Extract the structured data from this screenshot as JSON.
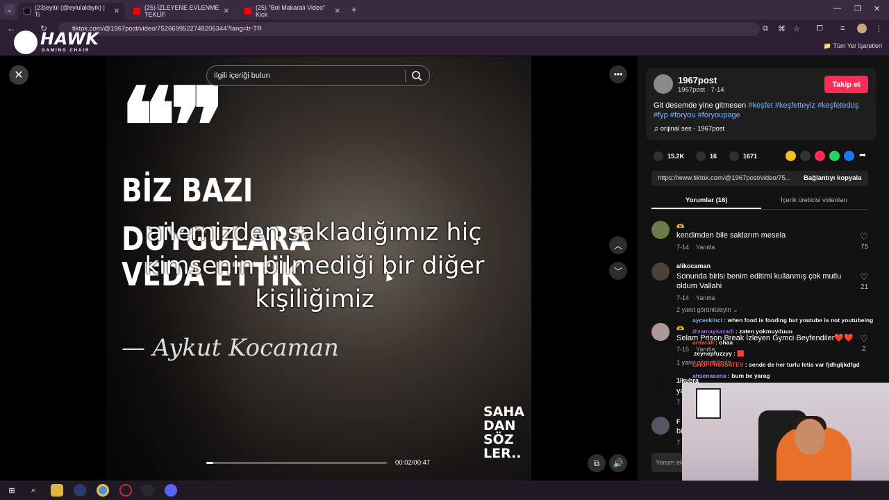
{
  "browser": {
    "tabs": [
      {
        "label": "(23)eylül (@eylulakbyik) | Ti",
        "active": true
      },
      {
        "label": "(25) İZLEYENE EVLENME TEKLİF",
        "active": false
      },
      {
        "label": "(25) \"Bol Makaralı Video\" Kick",
        "active": false
      }
    ],
    "new_tab": "+",
    "url": "tiktok.com/@1967post/video/7526699522748206344?lang=tr-TR",
    "bookmarks_all": "Tüm Yer İşaretleri"
  },
  "overlay_logo": {
    "brand": "HAWK",
    "sub": "GAMING CHAIR"
  },
  "search": {
    "placeholder": "İlgili içeriği bulun"
  },
  "video": {
    "bg_title_1": "BİZ BAZI",
    "bg_title_2": "DUYGULARA",
    "bg_title_3": "VEDA ETTİK",
    "overlay_text": "ailemizden sakladığımız hiç kimsenin bilmediği bir diğer kişiliğimiz",
    "signature": "— Aykut Kocaman",
    "watermark": "SAHA DAN SÖZ LER..",
    "time": "00:02/00:47",
    "progress": 0.04
  },
  "author": {
    "name": "1967post",
    "sub": "1967post · 7-14",
    "follow": "Takip et",
    "desc_text": "Git desemde yine gitmesen",
    "hashtags_line1": "#keşfet #keşfetteyiz #keşfetedüş",
    "hashtags_line2": "#fyp #foryou #foryoupage",
    "sound": "orijinal ses - 1967post"
  },
  "stats": {
    "likes": "15.2K",
    "comments": "16",
    "saves": "1671"
  },
  "link": {
    "url": "https://www.tiktok.com/@1967post/video/75...",
    "copy": "Bağlantıyı kopyala"
  },
  "tabs": {
    "comments": "Yorumlar (16)",
    "creator": "İçerik üreticisi videoları"
  },
  "comments": [
    {
      "user": "🫶",
      "text": "kendimden bile saklarım mesela",
      "date": "7-14",
      "reply": "Yanıtla",
      "likes": "75"
    },
    {
      "user": "alikocaman",
      "text": "Sonunda birisi benim editimi kullanmış çok mutlu oldum Vallahi",
      "date": "7-14",
      "reply": "Yanıtla",
      "likes": "21",
      "replies": "2 yanıt görüntüleyin"
    },
    {
      "user": "🫶",
      "text": "Selam Prison Break İzleyen Gymci Beyfendiler❤️❤️",
      "date": "7-15",
      "reply": "Yanıtla",
      "likes": "2",
      "replies": "1 yanıt görüntüleyin"
    },
    {
      "user": "1lkubra",
      "text": "ya",
      "date": "7"
    },
    {
      "user": "F",
      "text": "bi",
      "date": "7"
    }
  ],
  "comment_input": {
    "placeholder": "Yorum ek"
  },
  "chat": [
    {
      "user": "ayceekinci",
      "msg": ": when food is fooding but youtube is not youtubeing"
    },
    {
      "user": "dizamaysazadi",
      "msg": ": zaten yokmuyduuu"
    },
    {
      "user": "ardarall",
      "msg": ": ohaa"
    },
    {
      "user": "zeynepfuzzyy",
      "msg": ": 🟥"
    },
    {
      "user": "GHUPPR66SATEV",
      "msg": ": sende de her turlu fetis var fjdhgljkdfgd"
    },
    {
      "user": "ahsenasena",
      "msg": ": bum be yarag"
    }
  ],
  "colors": {
    "follow": "#fe2c55",
    "hashtag": "#7fb5ff",
    "chat_user_1": "#7ec3ff",
    "chat_user_2": "#a970ff",
    "chat_user_3": "#ff5c5c",
    "chat_user_4": "#ffffff",
    "chat_user_5": "#ff4d4d",
    "chat_user_6": "#b891ff"
  }
}
